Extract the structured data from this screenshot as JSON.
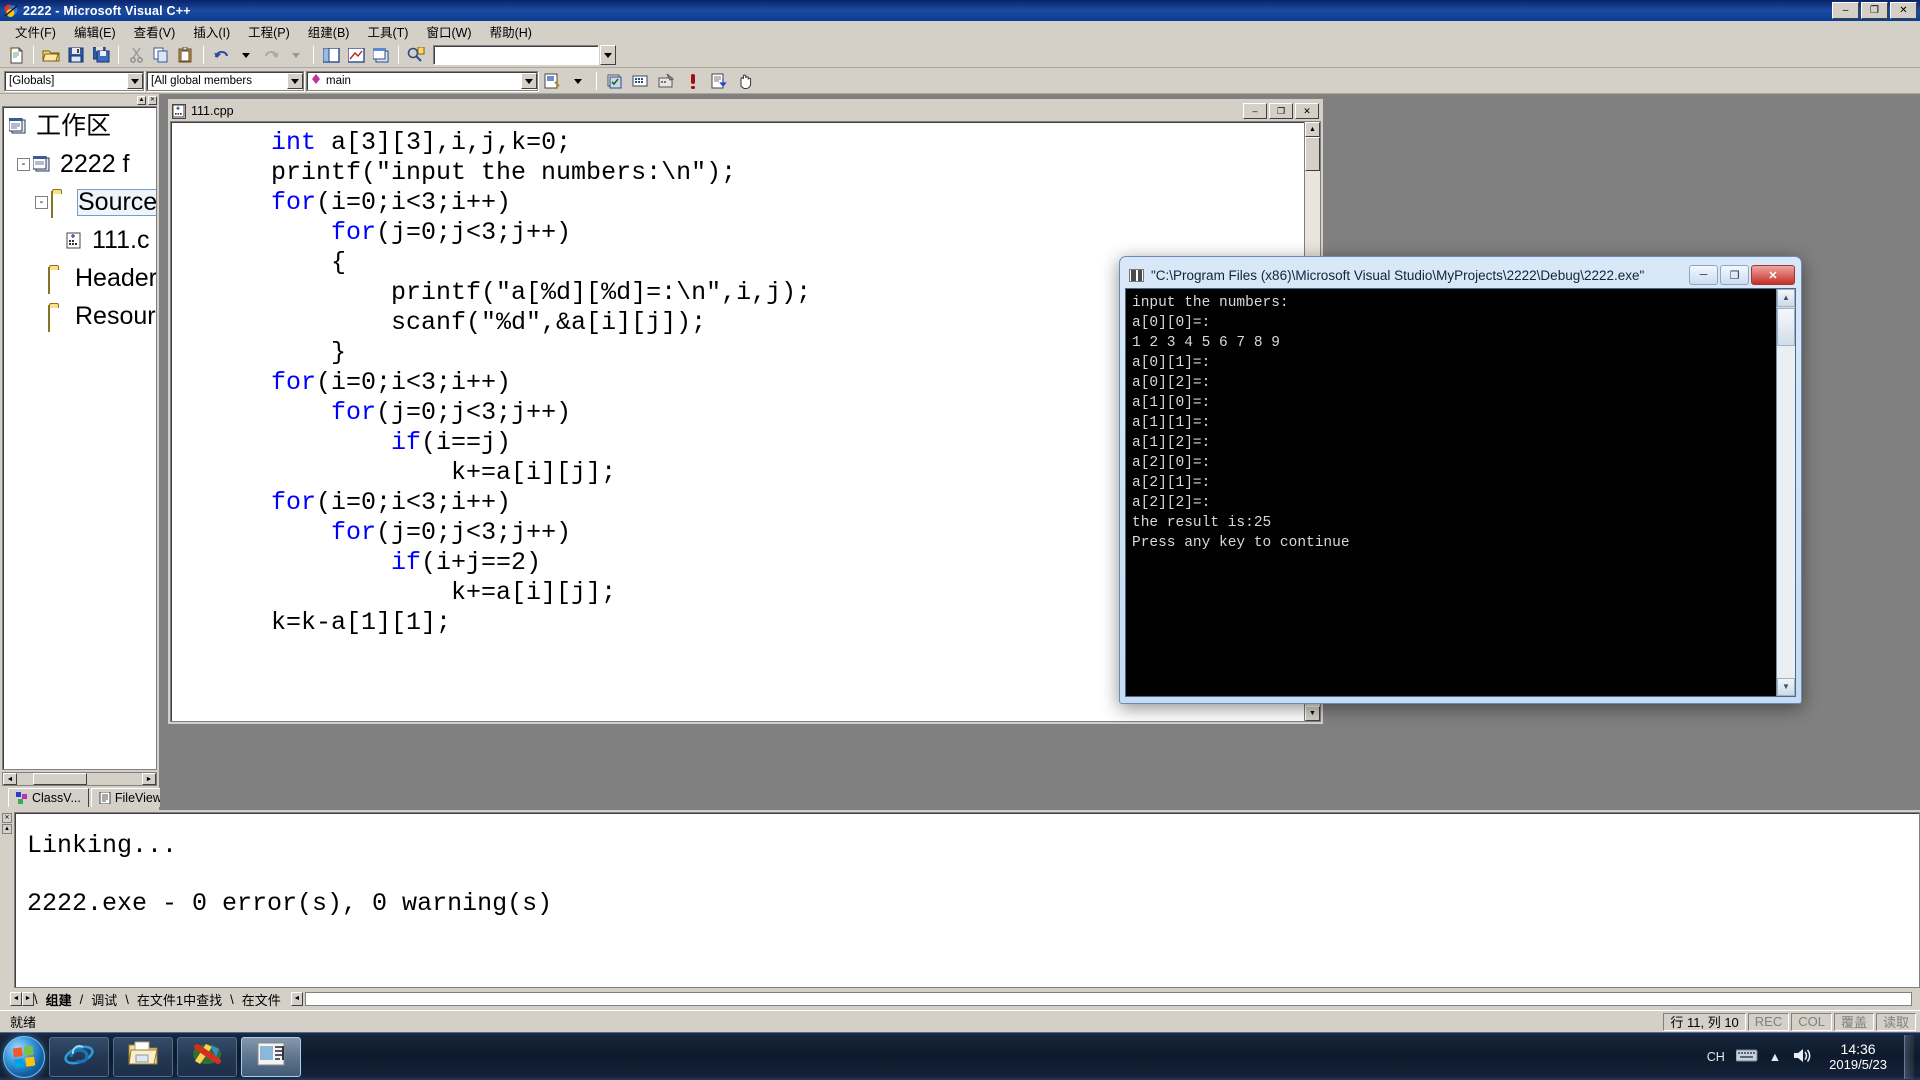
{
  "window": {
    "title": "2222 - Microsoft Visual C++",
    "minimize": "–",
    "maximize": "❐",
    "close": "✕"
  },
  "menubar": {
    "items": [
      {
        "label": "文件(F)",
        "name": "menu-file"
      },
      {
        "label": "编辑(E)",
        "name": "menu-edit"
      },
      {
        "label": "查看(V)",
        "name": "menu-view"
      },
      {
        "label": "插入(I)",
        "name": "menu-insert"
      },
      {
        "label": "工程(P)",
        "name": "menu-project"
      },
      {
        "label": "组建(B)",
        "name": "menu-build"
      },
      {
        "label": "工具(T)",
        "name": "menu-tools"
      },
      {
        "label": "窗口(W)",
        "name": "menu-window"
      },
      {
        "label": "帮助(H)",
        "name": "menu-help"
      }
    ]
  },
  "toolbar1": {
    "icons": [
      "new-file-icon",
      "open-folder-icon",
      "save-icon",
      "save-all-icon",
      "cut-icon",
      "copy-icon",
      "paste-icon",
      "undo-icon",
      "redo-icon",
      "workspace-icon",
      "output-window-icon",
      "window-list-icon",
      "find-in-files-icon"
    ],
    "find_value": "",
    "find_placeholder": ""
  },
  "toolbar2": {
    "scope_value": "[Globals]",
    "members_value": "[All global members",
    "function_value": "main",
    "icons": [
      "class-wizard-icon",
      "compile-icon",
      "build-icon",
      "build-execute-icon",
      "stop-icon",
      "go-icon",
      "insert-breakpoint-icon",
      "hand-icon"
    ]
  },
  "workspace": {
    "tree": [
      {
        "label": "工作区",
        "icon": "workspace-icon",
        "level": 0,
        "expander": "",
        "selected": false
      },
      {
        "label": "2222 f",
        "icon": "project-icon",
        "level": 1,
        "expander": "-",
        "selected": false
      },
      {
        "label": "Source",
        "icon": "folder-icon",
        "level": 2,
        "expander": "-",
        "selected": true
      },
      {
        "label": "111.c",
        "icon": "cpp-file-icon",
        "level": 3,
        "expander": "",
        "selected": false
      },
      {
        "label": "Header",
        "icon": "folder-icon",
        "level": 2,
        "expander": "",
        "selected": false
      },
      {
        "label": "Resour",
        "icon": "folder-icon",
        "level": 2,
        "expander": "",
        "selected": false
      }
    ],
    "tabs": [
      {
        "label": "ClassV...",
        "icon": "class-view-icon",
        "active": true
      },
      {
        "label": "FileView",
        "icon": "file-view-icon",
        "active": false
      }
    ]
  },
  "document": {
    "tab_title": "111.cpp",
    "minimize": "–",
    "maximize": "❐",
    "close": "✕",
    "code_lines": [
      [
        {
          "t": "    ",
          "k": false
        },
        {
          "t": "int",
          "k": true
        },
        {
          "t": " a[3][3],i,j,k=0;",
          "k": false
        }
      ],
      [
        {
          "t": "    printf(\"input the numbers:\\n\");",
          "k": false
        }
      ],
      [
        {
          "t": "    ",
          "k": false
        },
        {
          "t": "for",
          "k": true
        },
        {
          "t": "(i=0;i<3;i++)",
          "k": false
        }
      ],
      [
        {
          "t": "        ",
          "k": false
        },
        {
          "t": "for",
          "k": true
        },
        {
          "t": "(j=0;j<3;j++)",
          "k": false
        }
      ],
      [
        {
          "t": "        {",
          "k": false
        }
      ],
      [
        {
          "t": "            printf(\"a[%d][%d]=:\\n\",i,j);",
          "k": false
        }
      ],
      [
        {
          "t": "            scanf(\"%d\",&a[i][j]);",
          "k": false
        }
      ],
      [
        {
          "t": "        }",
          "k": false
        }
      ],
      [
        {
          "t": "    ",
          "k": false
        },
        {
          "t": "for",
          "k": true
        },
        {
          "t": "(i=0;i<3;i++)",
          "k": false
        }
      ],
      [
        {
          "t": "        ",
          "k": false
        },
        {
          "t": "for",
          "k": true
        },
        {
          "t": "(j=0;j<3;j++)",
          "k": false
        }
      ],
      [
        {
          "t": "            ",
          "k": false
        },
        {
          "t": "if",
          "k": true
        },
        {
          "t": "(i==j)",
          "k": false
        }
      ],
      [
        {
          "t": "                k+=a[i][j];",
          "k": false
        }
      ],
      [
        {
          "t": "    ",
          "k": false
        },
        {
          "t": "for",
          "k": true
        },
        {
          "t": "(i=0;i<3;i++)",
          "k": false
        }
      ],
      [
        {
          "t": "        ",
          "k": false
        },
        {
          "t": "for",
          "k": true
        },
        {
          "t": "(j=0;j<3;j++)",
          "k": false
        }
      ],
      [
        {
          "t": "            ",
          "k": false
        },
        {
          "t": "if",
          "k": true
        },
        {
          "t": "(i+j==2)",
          "k": false
        }
      ],
      [
        {
          "t": "                k+=a[i][j];",
          "k": false
        }
      ],
      [
        {
          "t": "    k=k-a[1][1];",
          "k": false
        }
      ]
    ]
  },
  "output": {
    "lines": [
      "Linking...",
      "2222.exe - 0 error(s), 0 warning(s)"
    ],
    "tabs": [
      {
        "label": "组建",
        "active": true
      },
      {
        "label": "调试",
        "active": false
      },
      {
        "label": "在文件1中查找",
        "active": false
      },
      {
        "label": "在文件",
        "active": false
      }
    ]
  },
  "statusbar": {
    "left": "就绪",
    "position": "行 11, 列 10",
    "rec": "REC",
    "col": "COL",
    "ovr": "覆盖",
    "read": "读取"
  },
  "console": {
    "title": "\"C:\\Program Files (x86)\\Microsoft Visual Studio\\MyProjects\\2222\\Debug\\2222.exe\"",
    "minimize": "─",
    "maximize": "❐",
    "close": "✕",
    "lines": [
      "input the numbers:",
      "a[0][0]=:",
      "1 2 3 4 5 6 7 8 9",
      "a[0][1]=:",
      "a[0][2]=:",
      "a[1][0]=:",
      "a[1][1]=:",
      "a[1][2]=:",
      "a[2][0]=:",
      "a[2][1]=:",
      "a[2][2]=:",
      "the result is:25",
      "Press any key to continue"
    ]
  },
  "taskbar": {
    "start_label": "Start",
    "tasks": [
      {
        "name": "taskbar-item-internet-explorer",
        "icon": "internet-explorer-icon"
      },
      {
        "name": "taskbar-item-explorer",
        "icon": "folder-explorer-icon"
      },
      {
        "name": "taskbar-item-media-player",
        "icon": "media-player-icon"
      },
      {
        "name": "taskbar-item-visual-cpp",
        "icon": "visual-cpp-icon",
        "active": true
      }
    ],
    "tray": {
      "ime": "CH",
      "keyboard": "keyboard-icon",
      "chevron": "▲",
      "volume": "volume-icon",
      "time": "14:36",
      "date": "2019/5/23"
    }
  },
  "colors": {
    "titlebar": "#0a3d91",
    "chrome": "#d4d0c8",
    "keyword": "#0000ff",
    "console_bg": "#000000",
    "console_fg": "#d8d8d8",
    "accent": "#ffe08a"
  }
}
